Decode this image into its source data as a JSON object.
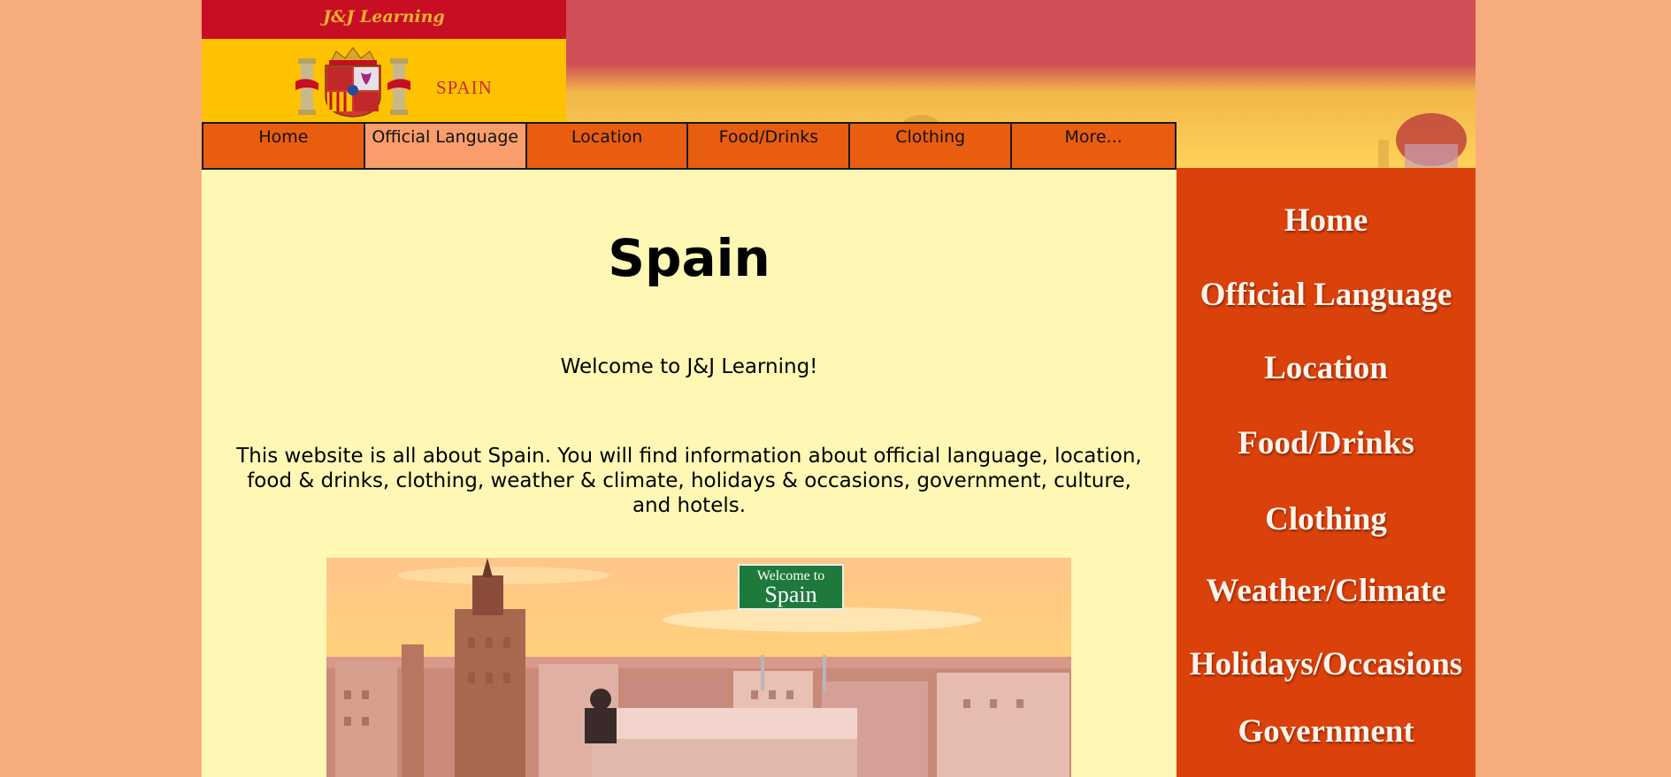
{
  "logo": {
    "title": "J&J Learning",
    "country": "SPAIN"
  },
  "topnav": {
    "items": [
      {
        "label": "Home"
      },
      {
        "label": "Official Language"
      },
      {
        "label": "Location"
      },
      {
        "label": "Food/Drinks"
      },
      {
        "label": "Clothing"
      },
      {
        "label": "More..."
      }
    ],
    "active_index": 1
  },
  "main": {
    "heading": "Spain",
    "welcome": "Welcome to J&J Learning!",
    "intro": "This website is all about Spain. You will find information about official language, location, food & drinks, clothing, weather & climate, holidays & occasions, government, culture, and hotels.",
    "hero_sign_line1": "Welcome to",
    "hero_sign_line2": "Spain"
  },
  "sidebar": {
    "items": [
      {
        "label": "Home"
      },
      {
        "label": "Official Language"
      },
      {
        "label": "Location"
      },
      {
        "label": "Food/Drinks"
      },
      {
        "label": "Clothing"
      },
      {
        "label": "Weather/Climate"
      },
      {
        "label": "Holidays/Occasions"
      },
      {
        "label": "Government"
      }
    ]
  },
  "colors": {
    "page_bg": "#f8ad7d",
    "content_bg": "#fff8b5",
    "nav_bg": "#e95d10",
    "nav_active": "#f99d6c",
    "sidebar_bg": "#db410b",
    "flag_red": "#c70e22",
    "flag_yellow": "#ffc200"
  }
}
